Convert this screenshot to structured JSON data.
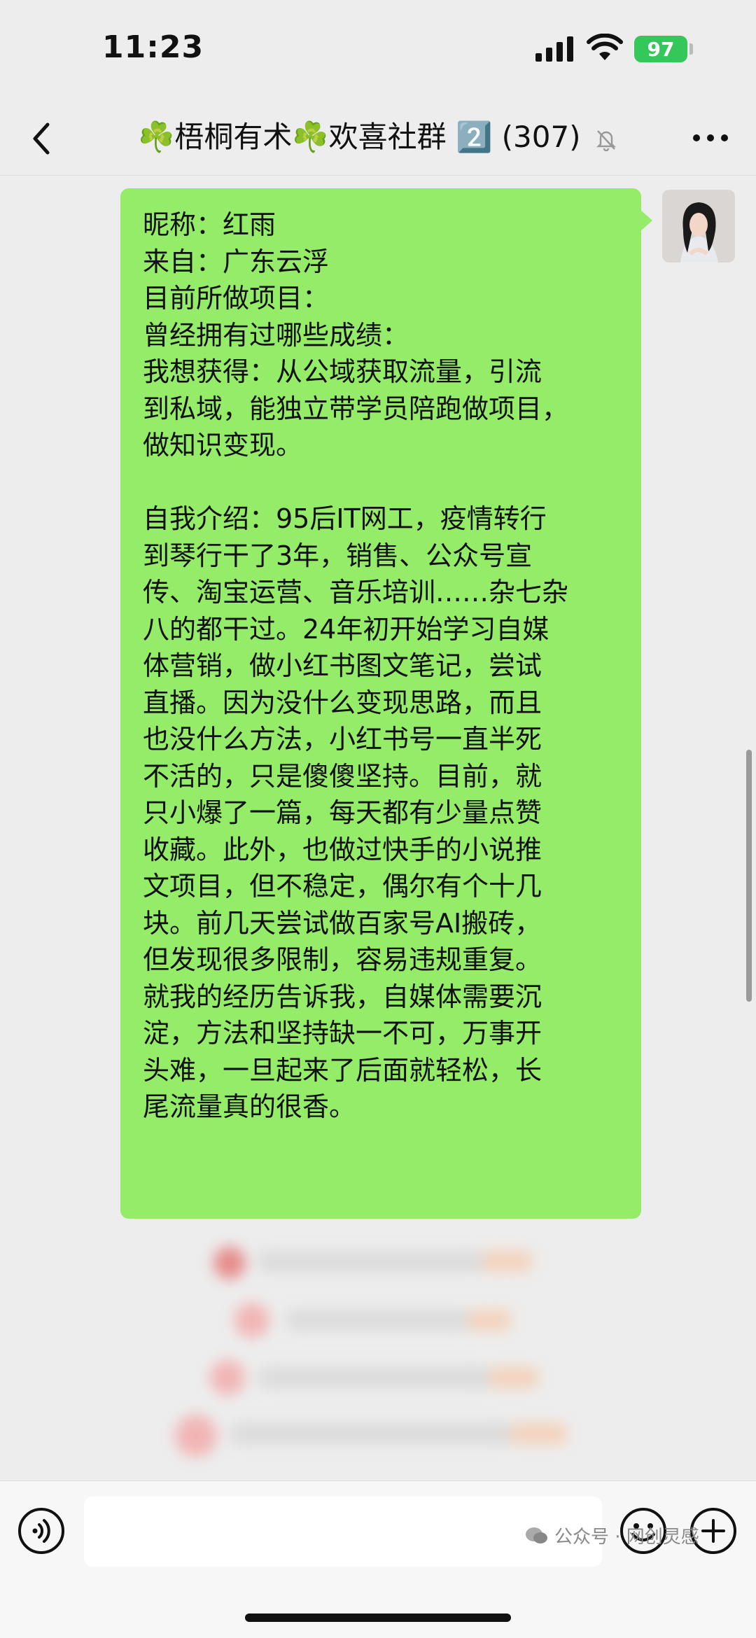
{
  "status_bar": {
    "time": "11:23",
    "battery": "97"
  },
  "nav": {
    "title": "☘️梧桐有术☘️欢喜社群 2️⃣ (307)",
    "back_icon": "chevron-left-icon",
    "mute_icon": "bell-off-icon",
    "more_icon": "ellipsis-icon"
  },
  "message": {
    "bubble_color": "#95ec69",
    "lines": [
      "昵称：红雨",
      "来自：广东云浮",
      "目前所做项目：",
      "曾经拥有过哪些成绩：",
      "我想获得：从公域获取流量，引流",
      "到私域，能独立带学员陪跑做项目，",
      "做知识变现。",
      "",
      "自我介绍：95后IT网工，疫情转行",
      "到琴行干了3年，销售、公众号宣",
      "传、淘宝运营、音乐培训……杂七杂",
      "八的都干过。24年初开始学习自媒",
      "体营销，做小红书图文笔记，尝试",
      "直播。因为没什么变现思路，而且",
      "也没什么方法，小红书号一直半死",
      "不活的，只是傻傻坚持。目前，就",
      "只小爆了一篇，每天都有少量点赞",
      "收藏。此外，也做过快手的小说推",
      "文项目，但不稳定，偶尔有个十几",
      "块。前几天尝试做百家号AI搬砖，",
      "但发现很多限制，容易违规重复。",
      "就我的经历告诉我，自媒体需要沉",
      "淀，方法和坚持缺一不可，万事开",
      "头难，一旦起来了后面就轻松，长",
      "尾流量真的很香。"
    ]
  },
  "input_bar": {
    "voice_icon": "voice-icon",
    "emoji_icon": "emoji-icon",
    "plus_icon": "plus-icon"
  },
  "watermark": {
    "text": "公众号 · 网创灵感"
  }
}
